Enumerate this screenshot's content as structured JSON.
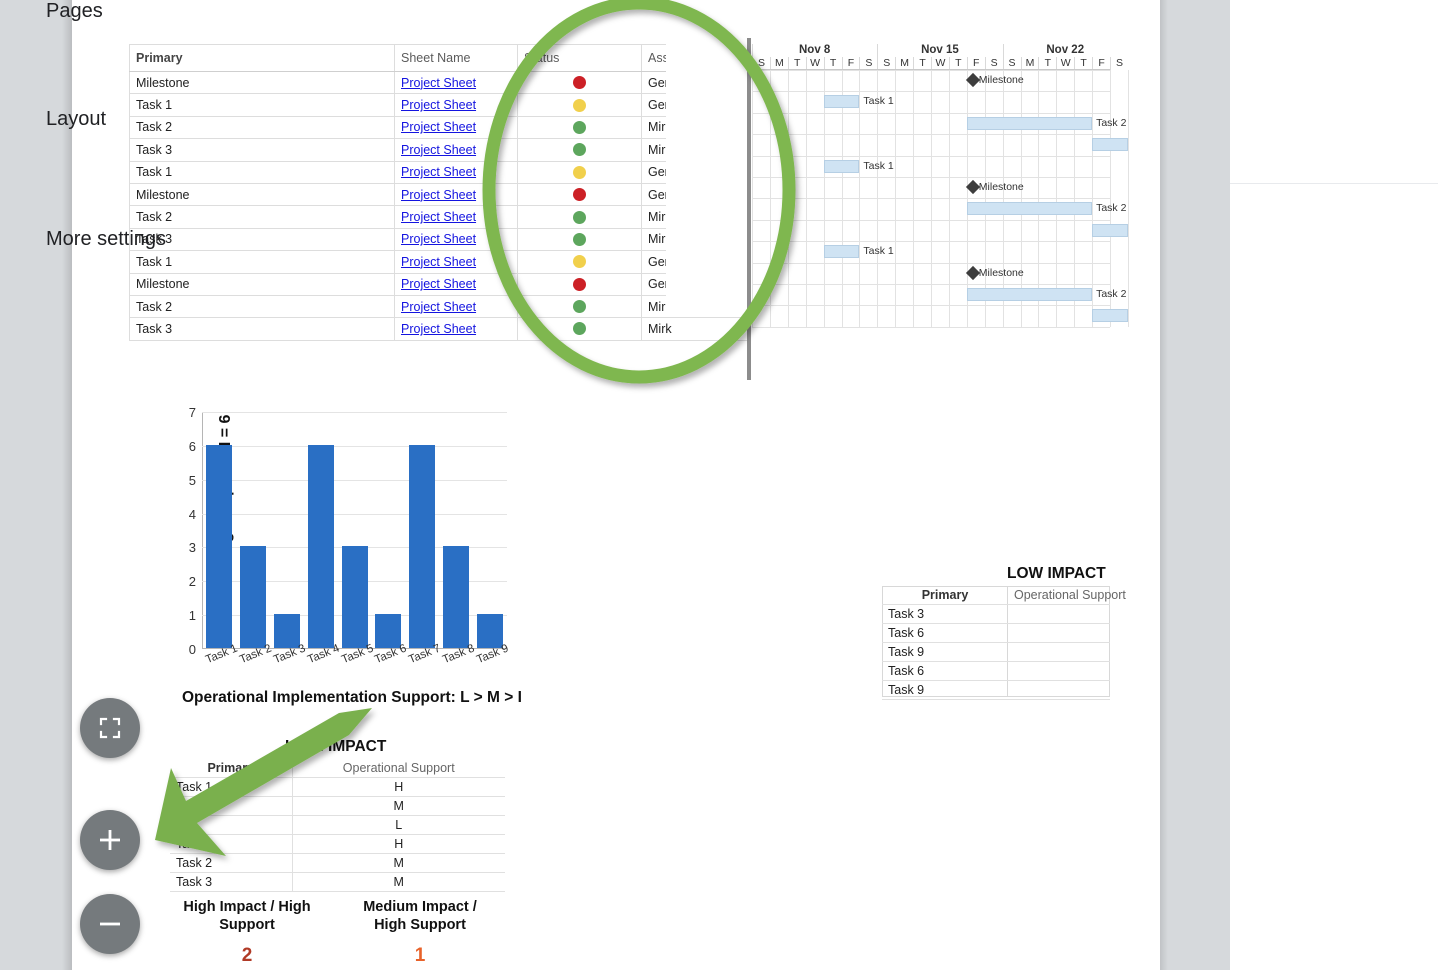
{
  "page": {
    "background_color": "#d6d9dc",
    "sheet_color": "#ffffff"
  },
  "task_grid": {
    "columns": [
      "Primary",
      "Sheet Name",
      "Status",
      "Assigned To"
    ],
    "rows": [
      {
        "primary": "Milestone",
        "sheet": "Project Sheet",
        "status": "red",
        "assigned": "Genevieve P."
      },
      {
        "primary": "Task 1",
        "sheet": "Project Sheet",
        "status": "yellow",
        "assigned": "Ger"
      },
      {
        "primary": "Task 2",
        "sheet": "Project Sheet",
        "status": "green",
        "assigned": "Mirk"
      },
      {
        "primary": "Task 3",
        "sheet": "Project Sheet",
        "status": "green",
        "assigned": "Mirk"
      },
      {
        "primary": "Task 1",
        "sheet": "Project Sheet",
        "status": "yellow",
        "assigned": "Ger"
      },
      {
        "primary": "Milestone",
        "sheet": "Project Sheet",
        "status": "red",
        "assigned": "Ger"
      },
      {
        "primary": "Task 2",
        "sheet": "Project Sheet",
        "status": "green",
        "assigned": "Mirk"
      },
      {
        "primary": "Task 3",
        "sheet": "Project Sheet",
        "status": "green",
        "assigned": "Mirk"
      },
      {
        "primary": "Task 1",
        "sheet": "Project Sheet",
        "status": "yellow",
        "assigned": "Ger"
      },
      {
        "primary": "Milestone",
        "sheet": "Project Sheet",
        "status": "red",
        "assigned": "Ger"
      },
      {
        "primary": "Task 2",
        "sheet": "Project Sheet",
        "status": "green",
        "assigned": "Mirk"
      },
      {
        "primary": "Task 3",
        "sheet": "Project Sheet",
        "status": "green",
        "assigned": "Mirk"
      }
    ],
    "status_colors": {
      "red": "#cc2026",
      "yellow": "#f1d04c",
      "green": "#5da65d"
    },
    "link_color": "#1414e0"
  },
  "gantt": {
    "weeks": [
      "Nov 8",
      "Nov 15",
      "Nov 22"
    ],
    "day_letters": [
      "S",
      "M",
      "T",
      "W",
      "T",
      "F",
      "S",
      "S",
      "M",
      "T",
      "W",
      "T",
      "F",
      "S",
      "S",
      "M",
      "T",
      "W",
      "T",
      "F",
      "S"
    ],
    "bar_color": "#cfe3f3",
    "milestone_color": "#3d3d3d",
    "items": [
      {
        "row": 0,
        "type": "milestone",
        "label": "Milestone",
        "start_day": 12
      },
      {
        "row": 1,
        "type": "bar",
        "label": "Task 1",
        "start_day": 4,
        "length_days": 2
      },
      {
        "row": 2,
        "type": "bar",
        "label": "Task 2",
        "start_day": 12,
        "length_days": 7
      },
      {
        "row": 3,
        "type": "bar",
        "label": "",
        "start_day": 19,
        "length_days": 2
      },
      {
        "row": 4,
        "type": "bar",
        "label": "Task 1",
        "start_day": 4,
        "length_days": 2
      },
      {
        "row": 5,
        "type": "milestone",
        "label": "Milestone",
        "start_day": 12
      },
      {
        "row": 6,
        "type": "bar",
        "label": "Task 2",
        "start_day": 12,
        "length_days": 7
      },
      {
        "row": 7,
        "type": "bar",
        "label": "",
        "start_day": 19,
        "length_days": 2
      },
      {
        "row": 8,
        "type": "bar",
        "label": "Task 1",
        "start_day": 4,
        "length_days": 2
      },
      {
        "row": 9,
        "type": "milestone",
        "label": "Milestone",
        "start_day": 12
      },
      {
        "row": 10,
        "type": "bar",
        "label": "Task 2",
        "start_day": 12,
        "length_days": 7
      },
      {
        "row": 11,
        "type": "bar",
        "label": "",
        "start_day": 19,
        "length_days": 2
      }
    ]
  },
  "chart_data": {
    "type": "bar",
    "title": "",
    "categories": [
      "Task 1",
      "Task 2",
      "Task 3",
      "Task 4",
      "Task 5",
      "Task 6",
      "Task 7",
      "Task 8",
      "Task 9"
    ],
    "values": [
      6,
      3,
      1,
      6,
      3,
      1,
      6,
      3,
      1
    ],
    "xlabel": "",
    "ylabel": "Strategic Impact: H = 6",
    "ylim": [
      0,
      7
    ],
    "yticks": [
      0,
      1,
      2,
      3,
      4,
      5,
      6,
      7
    ],
    "grid": true,
    "legend": false,
    "bar_color": "#2a6fc4"
  },
  "captions": {
    "operational_support": "Operational Implementation Support: L > M > I",
    "high_impact": "HIGH IMPACT",
    "low_impact": "LOW IMPACT"
  },
  "high_impact_table": {
    "columns": [
      "Primary",
      "Operational Support"
    ],
    "rows": [
      {
        "primary": "Task 1",
        "support": "H"
      },
      {
        "primary": "",
        "support": "M"
      },
      {
        "primary": "",
        "support": "L"
      },
      {
        "primary": "Task 1",
        "support": "H"
      },
      {
        "primary": "Task 2",
        "support": "M"
      },
      {
        "primary": "Task 3",
        "support": "M"
      }
    ]
  },
  "low_impact_table": {
    "columns": [
      "Primary",
      "Operational Support"
    ],
    "rows": [
      {
        "primary": "Task 3",
        "support": ""
      },
      {
        "primary": "Task 6",
        "support": ""
      },
      {
        "primary": "Task 9",
        "support": ""
      },
      {
        "primary": "Task 6",
        "support": ""
      },
      {
        "primary": "Task 9",
        "support": ""
      }
    ]
  },
  "summary": [
    {
      "label_line1": "High Impact / High",
      "label_line2": "Support",
      "value": "2",
      "color": "#b03a26"
    },
    {
      "label_line1": "Medium Impact /",
      "label_line2": "High Support",
      "value": "1",
      "color": "#e8622a"
    }
  ],
  "annotations": {
    "oval_color": "#7fb750",
    "arrow_color": "#7ab04e"
  },
  "zoom_controls": [
    {
      "name": "fit-to-screen",
      "icon": "fullscreen-icon"
    },
    {
      "name": "zoom-in",
      "icon": "plus-icon"
    },
    {
      "name": "zoom-out",
      "icon": "minus-icon"
    }
  ],
  "sidebar": {
    "items": [
      {
        "label": "Pages"
      },
      {
        "label": "Layout"
      },
      {
        "label": "More settings"
      }
    ]
  }
}
